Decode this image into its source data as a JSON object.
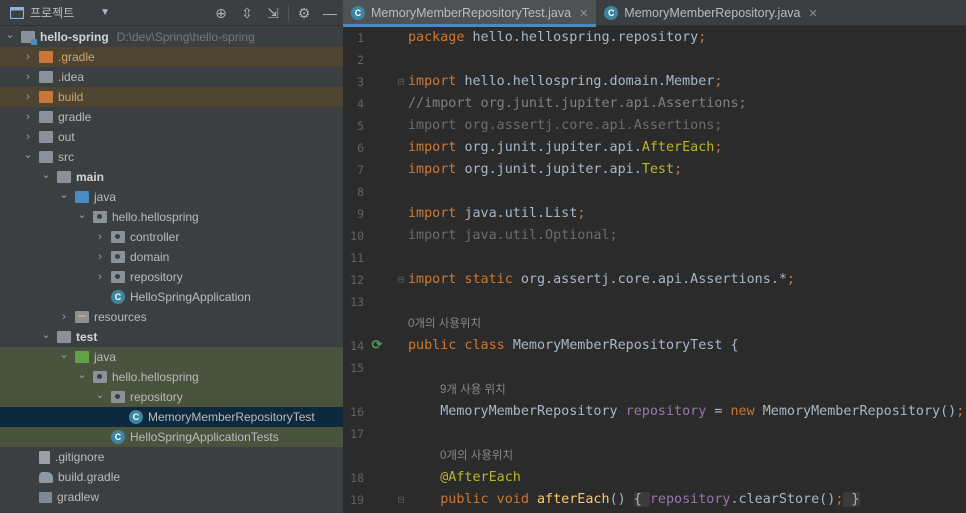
{
  "project_panel": {
    "title": "프로젝트",
    "tree": [
      {
        "label": "hello-spring",
        "hint": "D:\\dev\\Spring\\hello-spring",
        "depth": 0,
        "expanded": true,
        "icon": "module",
        "style": "bold"
      },
      {
        "label": ".gradle",
        "depth": 1,
        "expanded": false,
        "icon": "folder-orange",
        "row": "excl"
      },
      {
        "label": ".idea",
        "depth": 1,
        "expanded": false,
        "icon": "folder-gray"
      },
      {
        "label": "build",
        "depth": 1,
        "expanded": false,
        "icon": "folder-orange",
        "row": "excl"
      },
      {
        "label": "gradle",
        "depth": 1,
        "expanded": false,
        "icon": "folder-gray"
      },
      {
        "label": "out",
        "depth": 1,
        "expanded": false,
        "icon": "folder-gray"
      },
      {
        "label": "src",
        "depth": 1,
        "expanded": true,
        "icon": "folder-gray"
      },
      {
        "label": "main",
        "depth": 2,
        "expanded": true,
        "icon": "folder-gray",
        "style": "bold"
      },
      {
        "label": "java",
        "depth": 3,
        "expanded": true,
        "icon": "folder-blue"
      },
      {
        "label": "hello.hellospring",
        "depth": 4,
        "expanded": true,
        "icon": "folder-pkg"
      },
      {
        "label": "controller",
        "depth": 5,
        "expanded": false,
        "icon": "folder-pkg"
      },
      {
        "label": "domain",
        "depth": 5,
        "expanded": false,
        "icon": "folder-pkg"
      },
      {
        "label": "repository",
        "depth": 5,
        "expanded": false,
        "icon": "folder-pkg"
      },
      {
        "label": "HelloSpringApplication",
        "depth": 5,
        "icon": "cls",
        "leaf": true
      },
      {
        "label": "resources",
        "depth": 3,
        "expanded": false,
        "icon": "folder-res"
      },
      {
        "label": "test",
        "depth": 2,
        "expanded": true,
        "icon": "folder-gray",
        "style": "bold"
      },
      {
        "label": "java",
        "depth": 3,
        "expanded": true,
        "icon": "folder-green",
        "row": "test"
      },
      {
        "label": "hello.hellospring",
        "depth": 4,
        "expanded": true,
        "icon": "folder-pkg",
        "row": "test"
      },
      {
        "label": "repository",
        "depth": 5,
        "expanded": true,
        "icon": "folder-pkg",
        "row": "test"
      },
      {
        "label": "MemoryMemberRepositoryTest",
        "depth": 6,
        "icon": "cls",
        "leaf": true,
        "row": "sel"
      },
      {
        "label": "HelloSpringApplicationTests",
        "depth": 5,
        "icon": "cls",
        "leaf": true,
        "row": "test"
      },
      {
        "label": ".gitignore",
        "depth": 1,
        "icon": "file",
        "leaf": true
      },
      {
        "label": "build.gradle",
        "depth": 1,
        "icon": "gradle",
        "leaf": true
      },
      {
        "label": "gradlew",
        "depth": 1,
        "icon": "term",
        "leaf": true
      }
    ]
  },
  "tabs": [
    {
      "label": "MemoryMemberRepositoryTest.java",
      "active": true,
      "close": "✕"
    },
    {
      "label": "MemoryMemberRepository.java",
      "active": false,
      "close": "✕"
    }
  ],
  "code_lines": [
    {
      "n": "1",
      "tokens": [
        [
          "kw",
          "package "
        ],
        [
          "pl",
          "hello.hellospring.repository"
        ],
        [
          "kw",
          ";"
        ]
      ]
    },
    {
      "n": "2",
      "tokens": []
    },
    {
      "n": "3",
      "fold": true,
      "tokens": [
        [
          "kw",
          "import "
        ],
        [
          "pl",
          "hello.hellospring.domain.Member"
        ],
        [
          "kw",
          ";"
        ]
      ]
    },
    {
      "n": "4",
      "tokens": [
        [
          "cmt",
          "//import org.junit.jupiter.api.Assertions;"
        ]
      ]
    },
    {
      "n": "5",
      "tokens": [
        [
          "dim",
          "import org.assertj.core.api.Assertions;"
        ]
      ]
    },
    {
      "n": "6",
      "tokens": [
        [
          "kw",
          "import "
        ],
        [
          "pl",
          "org.junit.jupiter.api."
        ],
        [
          "ann",
          "AfterEach"
        ],
        [
          "kw",
          ";"
        ]
      ]
    },
    {
      "n": "7",
      "tokens": [
        [
          "kw",
          "import "
        ],
        [
          "pl",
          "org.junit.jupiter.api."
        ],
        [
          "ann",
          "Test"
        ],
        [
          "kw",
          ";"
        ]
      ]
    },
    {
      "n": "8",
      "tokens": []
    },
    {
      "n": "9",
      "tokens": [
        [
          "kw",
          "import "
        ],
        [
          "pl",
          "java.util.List"
        ],
        [
          "kw",
          ";"
        ]
      ]
    },
    {
      "n": "10",
      "tokens": [
        [
          "dim",
          "import java.util.Optional;"
        ]
      ]
    },
    {
      "n": "11",
      "tokens": []
    },
    {
      "n": "12",
      "fold": true,
      "tokens": [
        [
          "kw",
          "import static "
        ],
        [
          "pl",
          "org.assertj.core.api.Assertions.*"
        ],
        [
          "kw",
          ";"
        ]
      ]
    },
    {
      "n": "13",
      "tokens": []
    },
    {
      "hint": "0개의 사용위치",
      "indent": 0
    },
    {
      "n": "14",
      "run": true,
      "tokens": [
        [
          "kw",
          "public class "
        ],
        [
          "pl",
          "MemoryMemberRepositoryTest {"
        ]
      ]
    },
    {
      "n": "15",
      "tokens": []
    },
    {
      "hint": "9개 사용 위치",
      "indent": 1
    },
    {
      "n": "16",
      "tokens": [
        [
          "pl",
          "    MemoryMemberRepository "
        ],
        [
          "fld",
          "repository"
        ],
        [
          "pl",
          " = "
        ],
        [
          "kw",
          "new "
        ],
        [
          "pl",
          "MemoryMemberRepository()"
        ],
        [
          "kw",
          ";"
        ]
      ]
    },
    {
      "n": "17",
      "tokens": []
    },
    {
      "hint": "0개의 사용위치",
      "indent": 1
    },
    {
      "n": "18",
      "tokens": [
        [
          "ann",
          "    @AfterEach"
        ]
      ]
    },
    {
      "n": "19",
      "fold": true,
      "tokens": [
        [
          "kw",
          "    public void "
        ],
        [
          "fn",
          "afterEach"
        ],
        [
          "pl",
          "() "
        ],
        [
          "box",
          "{ "
        ],
        [
          "fld",
          "repository"
        ],
        [
          "pl",
          ".clearStore()"
        ],
        [
          "kw",
          ";"
        ],
        [
          "box",
          " }"
        ]
      ]
    }
  ]
}
